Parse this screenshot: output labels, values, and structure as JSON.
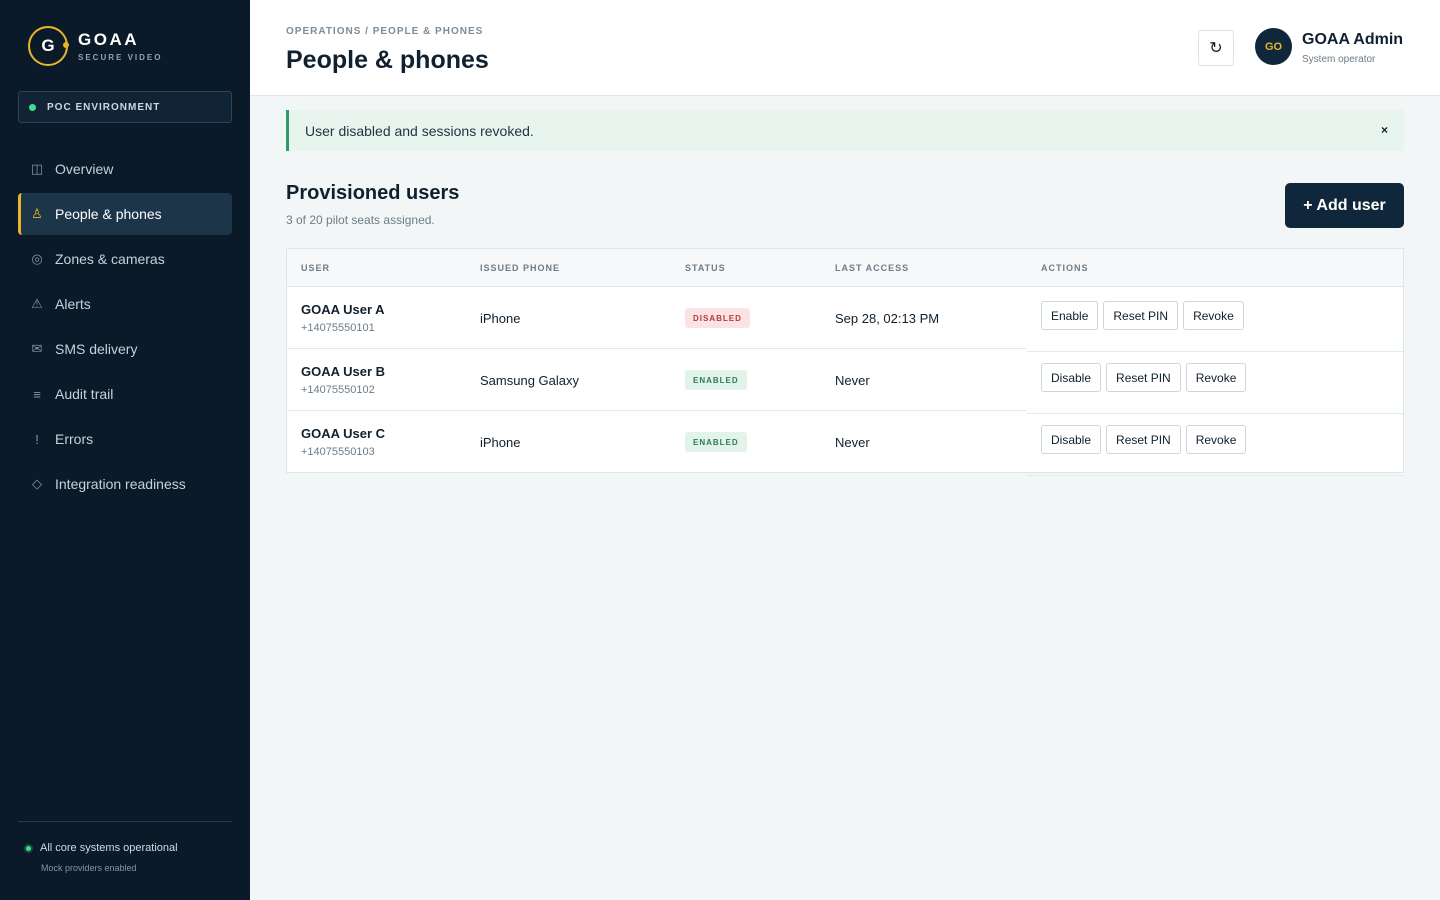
{
  "brand": {
    "logo_letter": "G",
    "name": "GOAA",
    "subtitle": "SECURE VIDEO"
  },
  "environment": {
    "label": "POC ENVIRONMENT"
  },
  "nav": {
    "items": [
      {
        "label": "Overview",
        "icon": "columns-icon",
        "glyph": "◫",
        "active": false
      },
      {
        "label": "People & phones",
        "icon": "person-icon",
        "glyph": "♙",
        "active": true
      },
      {
        "label": "Zones & cameras",
        "icon": "camera-icon",
        "glyph": "◎",
        "active": false
      },
      {
        "label": "Alerts",
        "icon": "warning-icon",
        "glyph": "⚠",
        "active": false
      },
      {
        "label": "SMS delivery",
        "icon": "envelope-icon",
        "glyph": "✉",
        "active": false
      },
      {
        "label": "Audit trail",
        "icon": "list-icon",
        "glyph": "≡",
        "active": false
      },
      {
        "label": "Errors",
        "icon": "exclamation-icon",
        "glyph": "!",
        "active": false
      },
      {
        "label": "Integration readiness",
        "icon": "diamond-icon",
        "glyph": "◇",
        "active": false
      }
    ]
  },
  "system_status": {
    "label": "All core systems operational",
    "sub": "Mock providers enabled"
  },
  "header": {
    "breadcrumb": "OPERATIONS / PEOPLE & PHONES",
    "title": "People & phones",
    "refresh_glyph": "↻"
  },
  "user": {
    "initials": "GO",
    "name": "GOAA Admin",
    "role": "System operator"
  },
  "alert": {
    "message": "User disabled and sessions revoked.",
    "close_glyph": "×"
  },
  "section": {
    "title": "Provisioned users",
    "subtitle": "3 of 20 pilot seats assigned.",
    "add_button": "+ Add user"
  },
  "table": {
    "columns": [
      "USER",
      "ISSUED PHONE",
      "STATUS",
      "LAST ACCESS",
      "ACTIONS"
    ],
    "rows": [
      {
        "name": "GOAA User A",
        "phone": "+14075550101",
        "device": "iPhone",
        "status": "DISABLED",
        "last_access": "Sep 28, 02:13 PM",
        "toggle": "Enable",
        "reset": "Reset PIN",
        "revoke": "Revoke"
      },
      {
        "name": "GOAA User B",
        "phone": "+14075550102",
        "device": "Samsung Galaxy",
        "status": "ENABLED",
        "last_access": "Never",
        "toggle": "Disable",
        "reset": "Reset PIN",
        "revoke": "Revoke"
      },
      {
        "name": "GOAA User C",
        "phone": "+14075550103",
        "device": "iPhone",
        "status": "ENABLED",
        "last_access": "Never",
        "toggle": "Disable",
        "reset": "Reset PIN",
        "revoke": "Revoke"
      }
    ]
  },
  "colors": {
    "sidebar": "#0b1a28",
    "accent": "#e8b62c",
    "success": "#3ddc97",
    "primary_button": "#10263a"
  }
}
